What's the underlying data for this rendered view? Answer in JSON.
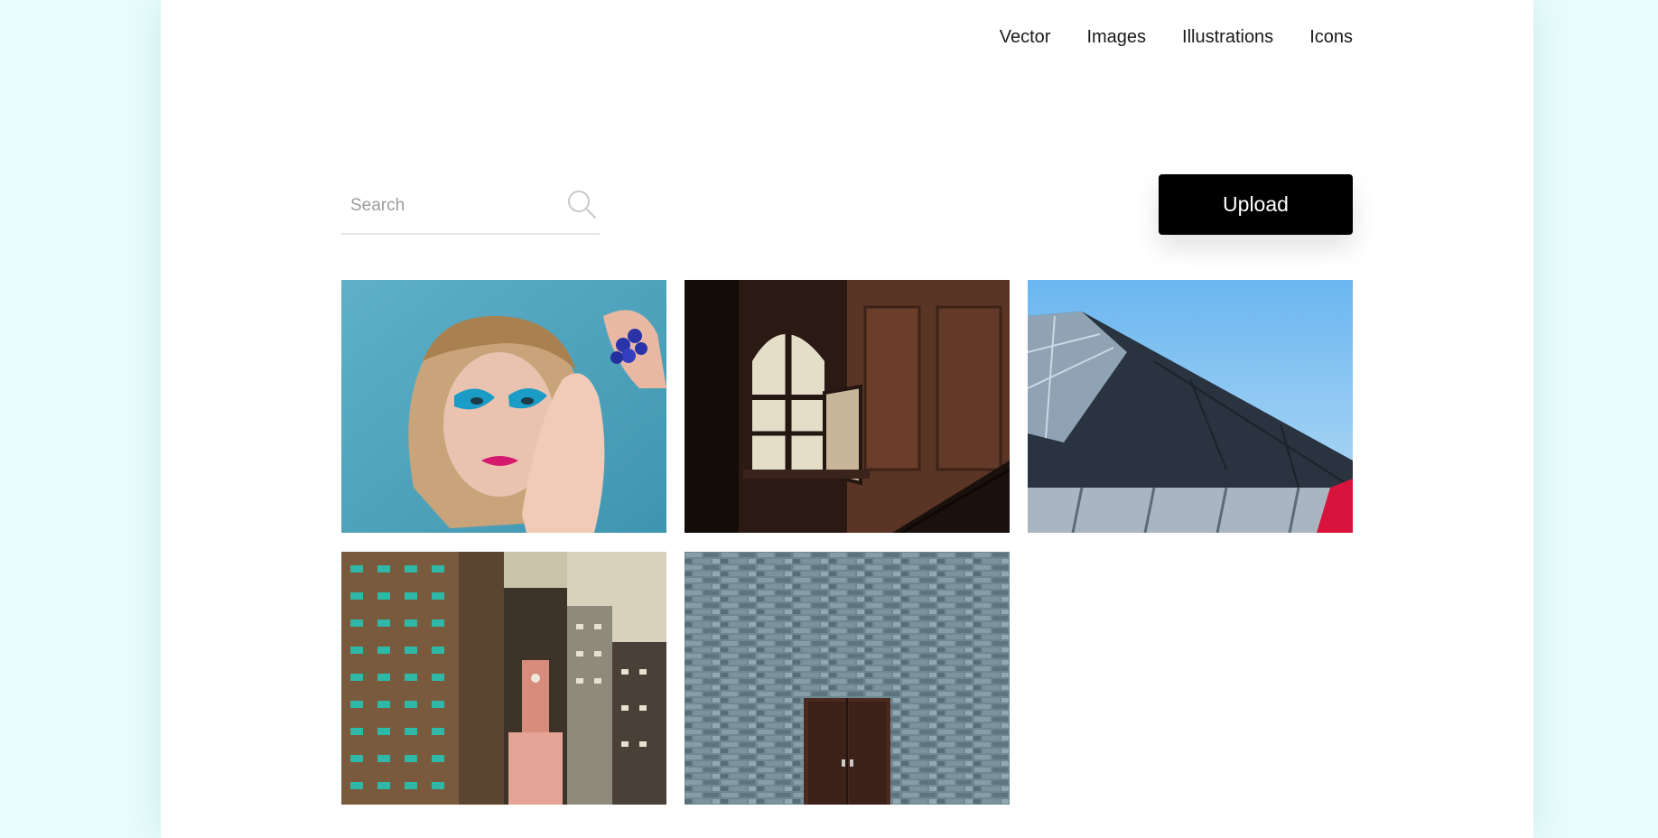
{
  "nav": {
    "items": [
      {
        "label": "Vector"
      },
      {
        "label": "Images"
      },
      {
        "label": "Illustrations"
      },
      {
        "label": "Icons"
      }
    ]
  },
  "search": {
    "placeholder": "Search",
    "value": "",
    "icon": "search-icon"
  },
  "upload": {
    "label": "Upload"
  },
  "gallery": {
    "images": [
      {
        "name": "portrait-blue-makeup"
      },
      {
        "name": "dark-room-window"
      },
      {
        "name": "roof-against-sky"
      },
      {
        "name": "city-apartment-towers"
      },
      {
        "name": "stone-wall-wooden-door"
      }
    ]
  },
  "colors": {
    "background": "#e8fdfc",
    "page": "#ffffff",
    "button": "#000000",
    "button_text": "#ffffff"
  }
}
